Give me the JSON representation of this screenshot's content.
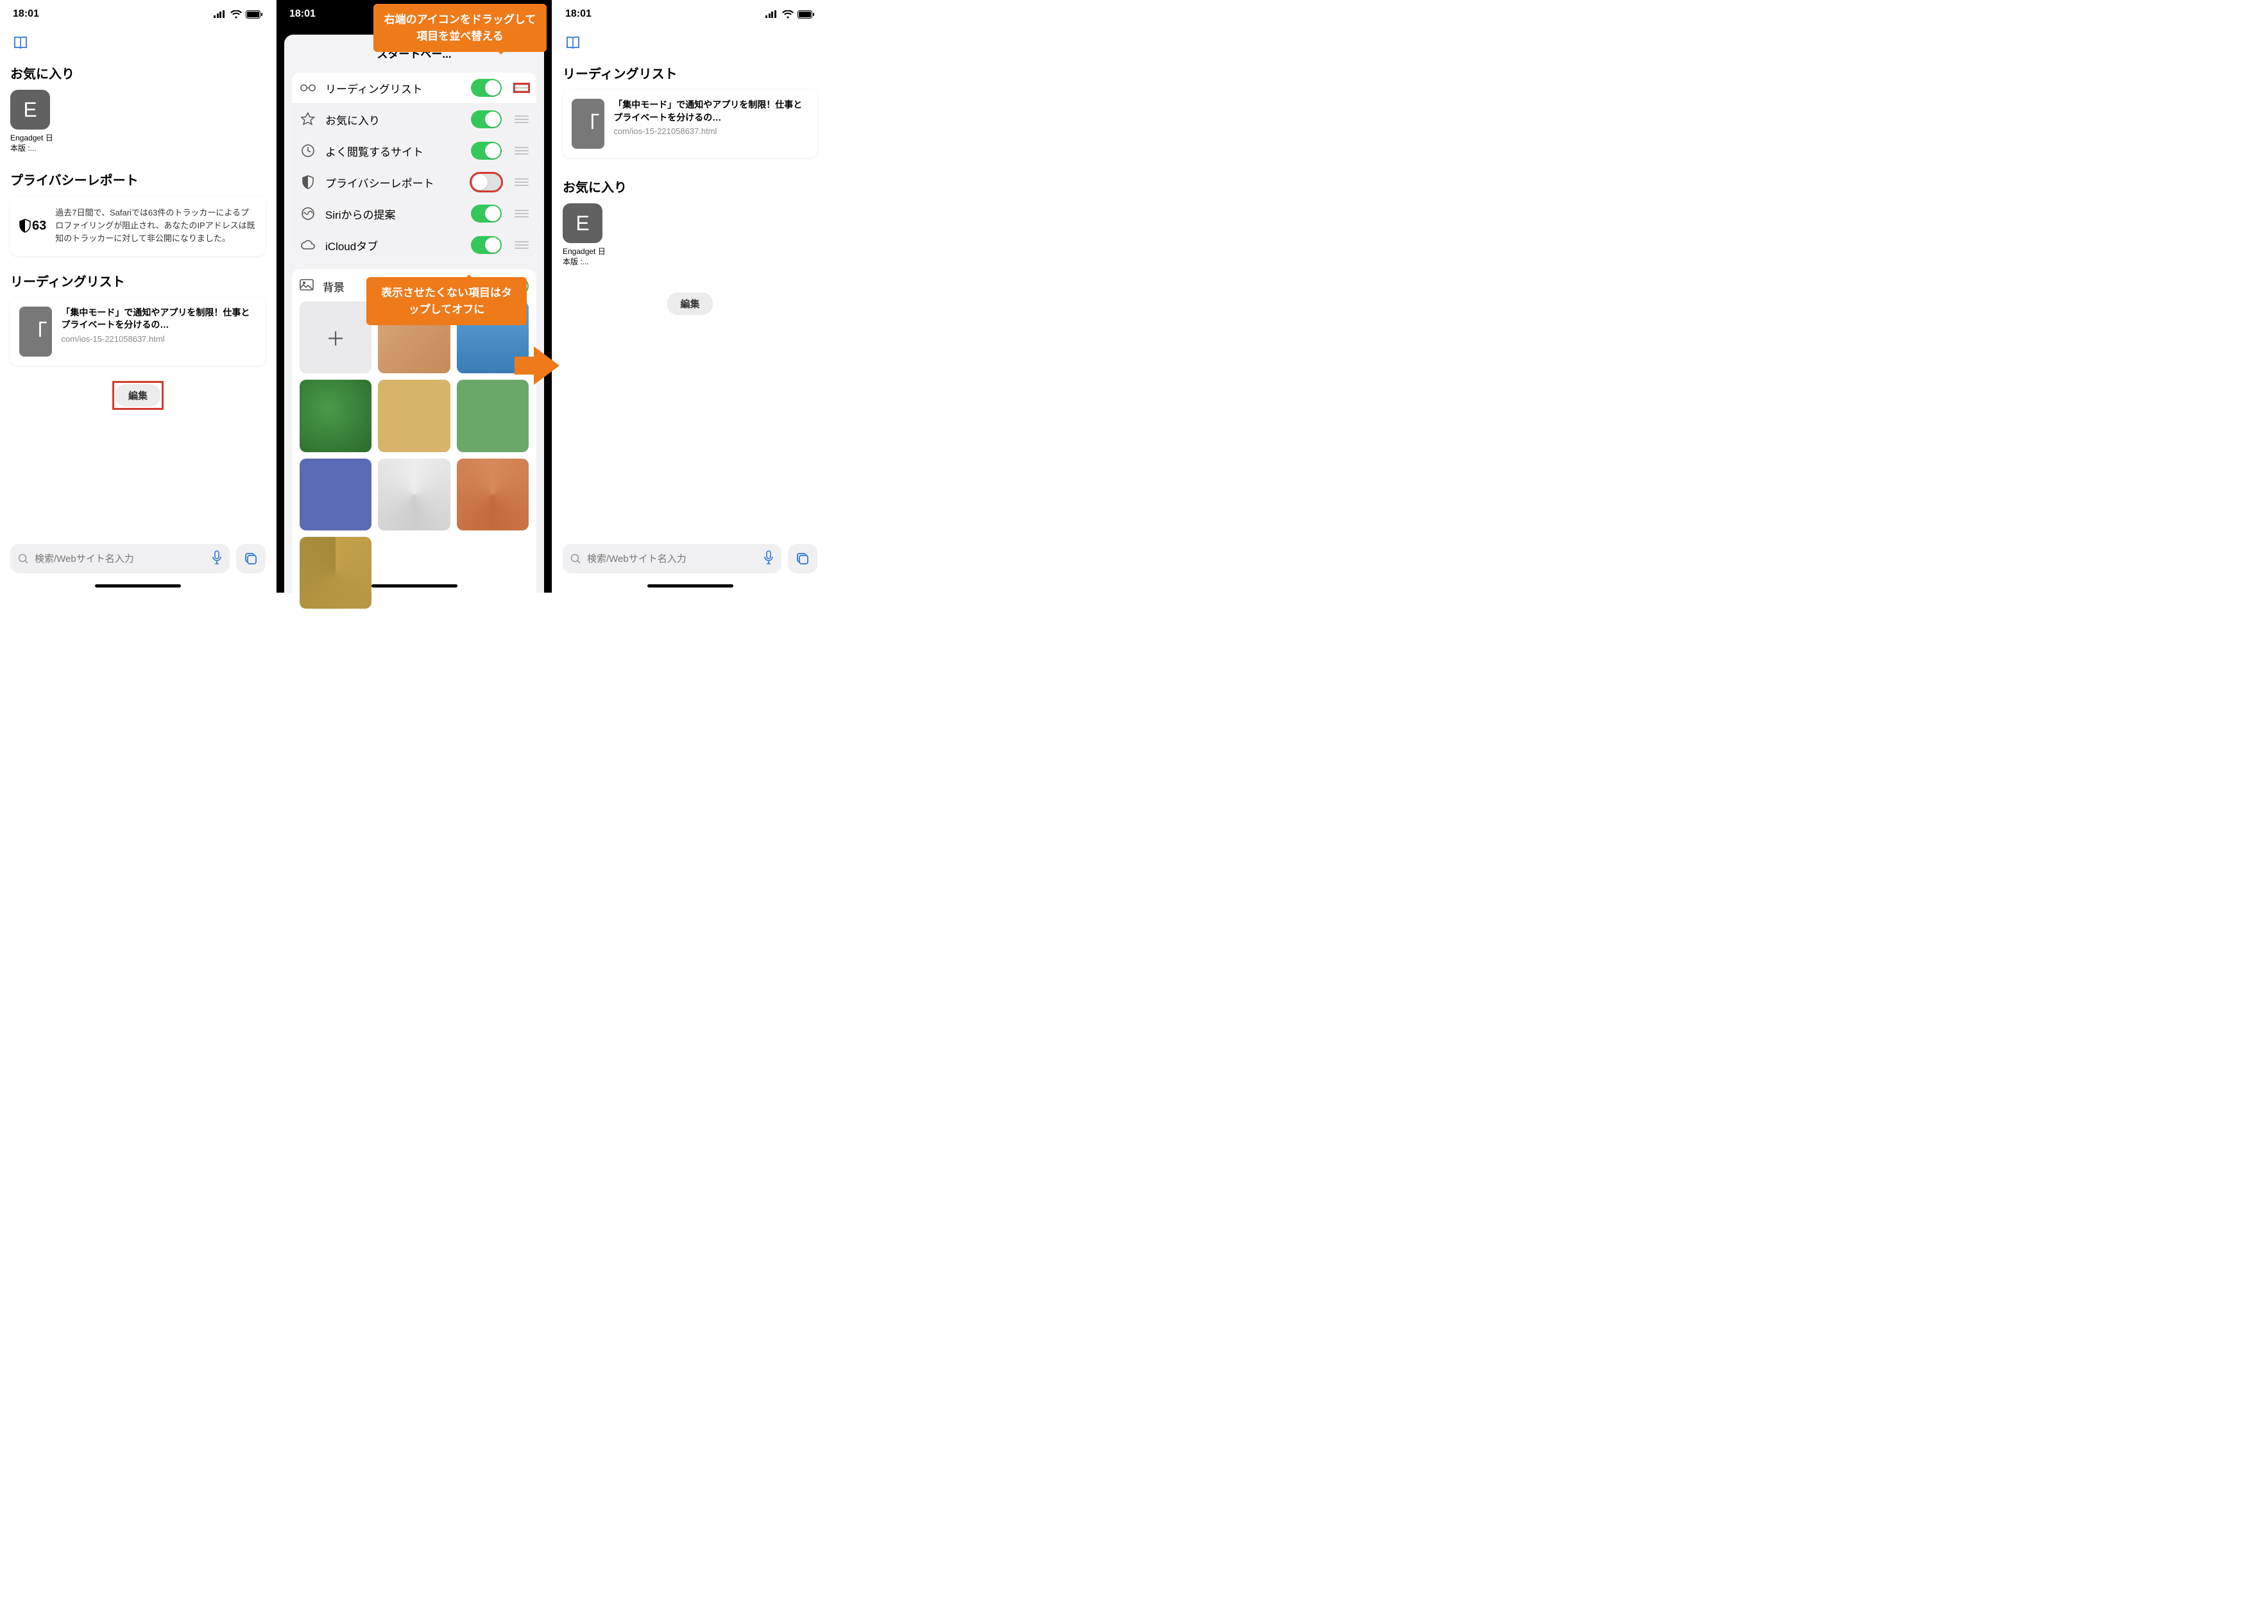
{
  "status": {
    "time": "18:01"
  },
  "left": {
    "favorites_title": "お気に入り",
    "fav_tile_letter": "E",
    "fav_caption": "Engadget 日本版 :...",
    "privacy_title": "プライバシーレポート",
    "privacy_count": "63",
    "privacy_text": "過去7日間で、Safariでは63件のトラッカーによるプロファイリングが阻止され、あなたのIPアドレスは既知のトラッカーに対して非公開になりました。",
    "reading_title": "リーディングリスト",
    "rl_article_title": "「集中モード」で通知やアプリを制限！仕事とプライベートを分けるの…",
    "rl_article_url": "com/ios-15-221058637.html",
    "edit_label": "編集",
    "search_placeholder": "検索/Webサイト名入力"
  },
  "middle": {
    "sheet_title": "スタートペー...",
    "items": [
      {
        "label": "リーディングリスト",
        "on": true,
        "icon": "glasses"
      },
      {
        "label": "お気に入り",
        "on": true,
        "icon": "star"
      },
      {
        "label": "よく閲覧するサイト",
        "on": true,
        "icon": "clock"
      },
      {
        "label": "プライバシーレポート",
        "on": false,
        "icon": "shield"
      },
      {
        "label": "Siriからの提案",
        "on": true,
        "icon": "siri"
      },
      {
        "label": "iCloudタブ",
        "on": true,
        "icon": "cloud"
      }
    ],
    "bg_label": "背景",
    "callout_top": "右端のアイコンをドラッグして項目を並べ替える",
    "callout_mid": "表示させたくない項目はタップしてオフに"
  },
  "right": {
    "reading_title": "リーディングリスト",
    "rl_article_title": "「集中モード」で通知やアプリを制限！仕事とプライベートを分けるの…",
    "rl_article_url": "com/ios-15-221058637.html",
    "favorites_title": "お気に入り",
    "fav_tile_letter": "E",
    "fav_caption": "Engadget 日本版 :...",
    "edit_label": "編集",
    "search_placeholder": "検索/Webサイト名入力"
  },
  "colors": {
    "accent": "#ef7a1a",
    "toggle_on": "#35c759",
    "link": "#2e77d0"
  }
}
